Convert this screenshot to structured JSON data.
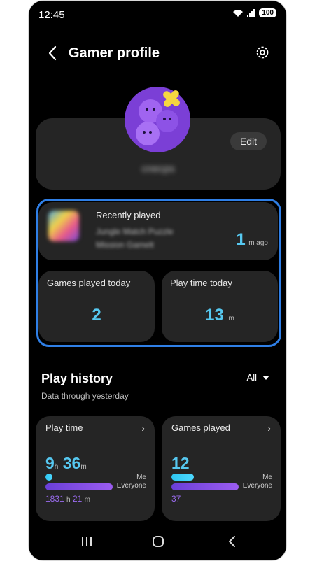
{
  "status": {
    "time": "12:45",
    "battery": "100"
  },
  "header": {
    "title": "Gamer profile"
  },
  "profile": {
    "edit_label": "Edit",
    "username": "cnecps"
  },
  "recent": {
    "title": "Recently played",
    "game_line1": "Jungle Match Puzzle",
    "game_line2": "Mission Gamelt",
    "ago_value": "1",
    "ago_unit": "m ago"
  },
  "stats": {
    "games_today_label": "Games played today",
    "games_today_value": "2",
    "playtime_today_label": "Play time today",
    "playtime_today_value": "13",
    "playtime_today_unit": "m"
  },
  "history": {
    "title": "Play history",
    "subtitle": "Data through yesterday",
    "filter": "All",
    "playtime": {
      "label": "Play time",
      "me_hours": "9",
      "h_unit": "h",
      "me_minutes": "36",
      "m_unit": "m",
      "me_label": "Me",
      "everyone_label": "Everyone",
      "everyone_hours": "1831",
      "everyone_minutes": "21"
    },
    "games": {
      "label": "Games played",
      "me_value": "12",
      "me_label": "Me",
      "everyone_label": "Everyone",
      "everyone_value": "37"
    }
  },
  "colors": {
    "accent_blue": "#56c8f0",
    "accent_purple": "#9b6cf0",
    "highlight": "#2f7fe6"
  },
  "icons": [
    "back-icon",
    "gear-icon",
    "wifi-icon",
    "signal-icon",
    "recents-icon",
    "home-icon",
    "nav-back-icon"
  ]
}
